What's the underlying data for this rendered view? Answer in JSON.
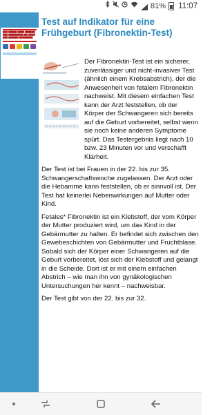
{
  "status_bar": {
    "battery": "81%",
    "time": "11:07",
    "icons": [
      "bluetooth-icon",
      "mute-icon",
      "alarm-icon",
      "wifi-icon",
      "signal-icon",
      "battery-icon"
    ]
  },
  "page": {
    "title": "Test auf Indikator für eine Frühgeburt (Fibronektin-Test)",
    "paragraphs": [
      "Der Fibronektin-Test ist ein sicherer, zuverlässiger und nicht-invasiver Test (ähnlich einem Krebsabstrich), der die Anwesenheit von fetalem Fibronektin nachweist. Mit diesem einfachen Test kann der Arzt feststellen, ob der Körper der Schwangeren sich bereits auf die Geburt vorbereitet, selbst wenn sie noch keine anderen Symptome spürt. Das Testergebnis liegt nach 10 bzw. 23 Minuten vor und verschafft Klarheit.",
      "Der Test ist bei Frauen in der 22. bis zur 35. Schwangerschaftswoche zugelassen. Der Arzt oder die Hebamme kann feststellen, ob er sinnvoll ist. Der Test hat keinerlei Nebenwirkungen auf Mutter oder Kind.",
      "Fetales* Fibronektin ist ein Klebstoff, der vom Körper der Mutter produziert wird, um das Kind in der Gebärmutter zu halten. Er befindet sich zwischen den Gewebeschichten von Gebärmutter und Fruchtblase. Sobald sich der Körper einer Schwangeren auf die Geburt vorbereitet, löst sich der Klebstoff und gelangt in die Scheide. Dort ist er mit einem einfachen Abstrich – wie man ihn von gynäkologischen Untersuchungen her kennt – nachweisbar.",
      "Der Test gibt von der 22. bis zur 32."
    ]
  },
  "colors": {
    "sidebar": "#3f98c8",
    "title": "#2b88be",
    "logo_red": "#cc1f1f"
  },
  "nav_bar": {
    "buttons": [
      "dot-icon",
      "recents-icon",
      "home-icon",
      "back-icon"
    ]
  }
}
